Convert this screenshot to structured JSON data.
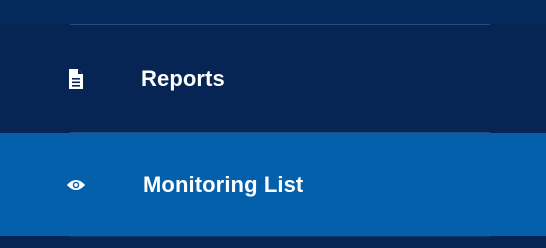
{
  "sidebar": {
    "items": [
      {
        "label": "Reports",
        "icon": "document-icon",
        "active": false
      },
      {
        "label": "Monitoring List",
        "icon": "eye-icon",
        "active": true
      }
    ]
  },
  "colors": {
    "background": "#062554",
    "active_background": "#0560ab",
    "divider": "#274a7a",
    "text": "#ffffff"
  }
}
